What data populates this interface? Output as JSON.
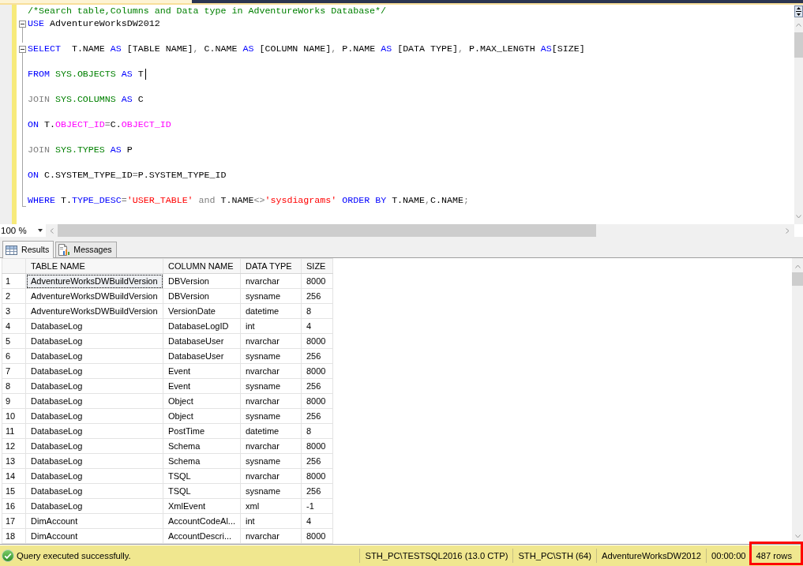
{
  "editor": {
    "modified": true,
    "lines": [
      {
        "kind": "code",
        "collapsible": false,
        "cursor": false,
        "tokens": [
          {
            "text": "/*Search table,Columns and Data type in AdventureWorks Database*/",
            "kind": "comment"
          }
        ]
      },
      {
        "kind": "code",
        "collapsible": true,
        "cursor": false,
        "tokens": [
          {
            "text": "USE",
            "kind": "keyword"
          },
          {
            "text": " AdventureWorksDW2012",
            "kind": "plain"
          }
        ]
      },
      {
        "kind": "blank"
      },
      {
        "kind": "code",
        "collapsible": true,
        "cursor": false,
        "tokens": [
          {
            "text": "SELECT",
            "kind": "keyword"
          },
          {
            "text": "  T.NAME ",
            "kind": "plain"
          },
          {
            "text": "AS",
            "kind": "keyword"
          },
          {
            "text": " [TABLE NAME]",
            "kind": "plain"
          },
          {
            "text": ",",
            "kind": "operator"
          },
          {
            "text": " C.NAME ",
            "kind": "plain"
          },
          {
            "text": "AS",
            "kind": "keyword"
          },
          {
            "text": " [COLUMN NAME]",
            "kind": "plain"
          },
          {
            "text": ",",
            "kind": "operator"
          },
          {
            "text": " P.NAME ",
            "kind": "plain"
          },
          {
            "text": "AS",
            "kind": "keyword"
          },
          {
            "text": " [DATA TYPE]",
            "kind": "plain"
          },
          {
            "text": ",",
            "kind": "operator"
          },
          {
            "text": " P.MAX_LENGTH ",
            "kind": "plain"
          },
          {
            "text": "AS",
            "kind": "keyword"
          },
          {
            "text": "[SIZE]",
            "kind": "plain"
          }
        ]
      },
      {
        "kind": "blank"
      },
      {
        "kind": "code",
        "collapsible": false,
        "cursor": true,
        "tokens": [
          {
            "text": "FROM",
            "kind": "keyword"
          },
          {
            "text": " SYS.OBJECTS",
            "kind": "object"
          },
          {
            "text": " AS",
            "kind": "keyword"
          },
          {
            "text": " T",
            "kind": "plain"
          }
        ]
      },
      {
        "kind": "blank"
      },
      {
        "kind": "code",
        "collapsible": false,
        "cursor": false,
        "tokens": [
          {
            "text": "JOIN",
            "kind": "operator"
          },
          {
            "text": " SYS.COLUMNS",
            "kind": "object"
          },
          {
            "text": " AS",
            "kind": "keyword"
          },
          {
            "text": " C",
            "kind": "plain"
          }
        ]
      },
      {
        "kind": "blank"
      },
      {
        "kind": "code",
        "collapsible": false,
        "cursor": false,
        "tokens": [
          {
            "text": "ON",
            "kind": "keyword"
          },
          {
            "text": " T.",
            "kind": "plain"
          },
          {
            "text": "OBJECT_ID",
            "kind": "function"
          },
          {
            "text": "=",
            "kind": "operator"
          },
          {
            "text": "C.",
            "kind": "plain"
          },
          {
            "text": "OBJECT_ID",
            "kind": "function"
          }
        ]
      },
      {
        "kind": "blank"
      },
      {
        "kind": "code",
        "collapsible": false,
        "cursor": false,
        "tokens": [
          {
            "text": "JOIN",
            "kind": "operator"
          },
          {
            "text": " SYS.TYPES",
            "kind": "object"
          },
          {
            "text": " AS",
            "kind": "keyword"
          },
          {
            "text": " P",
            "kind": "plain"
          }
        ]
      },
      {
        "kind": "blank"
      },
      {
        "kind": "code",
        "collapsible": false,
        "cursor": false,
        "tokens": [
          {
            "text": "ON",
            "kind": "keyword"
          },
          {
            "text": " C.SYSTEM_TYPE_ID",
            "kind": "plain"
          },
          {
            "text": "=",
            "kind": "operator"
          },
          {
            "text": "P.SYSTEM_TYPE_ID",
            "kind": "plain"
          }
        ]
      },
      {
        "kind": "blank"
      },
      {
        "kind": "code",
        "collapsible": false,
        "cursor": false,
        "tokens": [
          {
            "text": "WHERE",
            "kind": "keyword"
          },
          {
            "text": " T.",
            "kind": "plain"
          },
          {
            "text": "TYPE_DESC",
            "kind": "keyword"
          },
          {
            "text": "=",
            "kind": "operator"
          },
          {
            "text": "'USER_TABLE'",
            "kind": "string"
          },
          {
            "text": " and",
            "kind": "operator"
          },
          {
            "text": " T.NAME",
            "kind": "plain"
          },
          {
            "text": "<>",
            "kind": "operator"
          },
          {
            "text": "'sysdiagrams'",
            "kind": "string"
          },
          {
            "text": " ORDER BY",
            "kind": "keyword"
          },
          {
            "text": " T.NAME",
            "kind": "plain"
          },
          {
            "text": ",",
            "kind": "operator"
          },
          {
            "text": "C.NAME",
            "kind": "plain"
          },
          {
            "text": ";",
            "kind": "operator"
          }
        ]
      }
    ]
  },
  "zoom": "100 %",
  "results": {
    "tabs": [
      {
        "label": "Results",
        "selected": true
      },
      {
        "label": "Messages",
        "selected": false
      }
    ],
    "columns": [
      "TABLE NAME",
      "COLUMN NAME",
      "DATA TYPE",
      "SIZE"
    ],
    "rows": [
      {
        "number": "1",
        "cells": [
          "AdventureWorksDWBuildVersion",
          "DBVersion",
          "nvarchar",
          "8000"
        ],
        "focused": true
      },
      {
        "number": "2",
        "cells": [
          "AdventureWorksDWBuildVersion",
          "DBVersion",
          "sysname",
          "256"
        ],
        "focused": false
      },
      {
        "number": "3",
        "cells": [
          "AdventureWorksDWBuildVersion",
          "VersionDate",
          "datetime",
          "8"
        ],
        "focused": false
      },
      {
        "number": "4",
        "cells": [
          "DatabaseLog",
          "DatabaseLogID",
          "int",
          "4"
        ],
        "focused": false
      },
      {
        "number": "5",
        "cells": [
          "DatabaseLog",
          "DatabaseUser",
          "nvarchar",
          "8000"
        ],
        "focused": false
      },
      {
        "number": "6",
        "cells": [
          "DatabaseLog",
          "DatabaseUser",
          "sysname",
          "256"
        ],
        "focused": false
      },
      {
        "number": "7",
        "cells": [
          "DatabaseLog",
          "Event",
          "nvarchar",
          "8000"
        ],
        "focused": false
      },
      {
        "number": "8",
        "cells": [
          "DatabaseLog",
          "Event",
          "sysname",
          "256"
        ],
        "focused": false
      },
      {
        "number": "9",
        "cells": [
          "DatabaseLog",
          "Object",
          "nvarchar",
          "8000"
        ],
        "focused": false
      },
      {
        "number": "10",
        "cells": [
          "DatabaseLog",
          "Object",
          "sysname",
          "256"
        ],
        "focused": false
      },
      {
        "number": "11",
        "cells": [
          "DatabaseLog",
          "PostTime",
          "datetime",
          "8"
        ],
        "focused": false
      },
      {
        "number": "12",
        "cells": [
          "DatabaseLog",
          "Schema",
          "nvarchar",
          "8000"
        ],
        "focused": false
      },
      {
        "number": "13",
        "cells": [
          "DatabaseLog",
          "Schema",
          "sysname",
          "256"
        ],
        "focused": false
      },
      {
        "number": "14",
        "cells": [
          "DatabaseLog",
          "TSQL",
          "nvarchar",
          "8000"
        ],
        "focused": false
      },
      {
        "number": "15",
        "cells": [
          "DatabaseLog",
          "TSQL",
          "sysname",
          "256"
        ],
        "focused": false
      },
      {
        "number": "16",
        "cells": [
          "DatabaseLog",
          "XmlEvent",
          "xml",
          "-1"
        ],
        "focused": false
      },
      {
        "number": "17",
        "cells": [
          "DimAccount",
          "AccountCodeAl...",
          "int",
          "4"
        ],
        "focused": false
      },
      {
        "number": "18",
        "cells": [
          "DimAccount",
          "AccountDescri...",
          "nvarchar",
          "8000"
        ],
        "focused": false
      }
    ]
  },
  "status_bar": {
    "succeeded": true,
    "message": "Query executed successfully.",
    "segments": [
      {
        "text": "STH_PC\\TESTSQL2016 (13.0 CTP)",
        "highlighted": false
      },
      {
        "text": "STH_PC\\STH (64)",
        "highlighted": false
      },
      {
        "text": "AdventureWorksDW2012",
        "highlighted": false
      },
      {
        "text": "00:00:00",
        "highlighted": false
      },
      {
        "text": "487 rows",
        "highlighted": true
      }
    ]
  }
}
